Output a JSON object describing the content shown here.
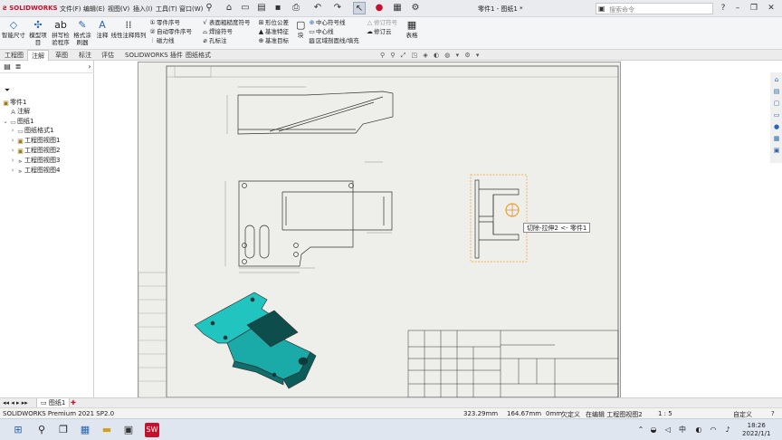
{
  "app": {
    "logo_text": "SOLIDWORKS",
    "doc_title": "零件1 - 图纸1 *"
  },
  "menu": [
    {
      "label": "文件(F)"
    },
    {
      "label": "编辑(E)"
    },
    {
      "label": "视图(V)"
    },
    {
      "label": "插入(I)"
    },
    {
      "label": "工具(T)"
    },
    {
      "label": "窗口(W)"
    }
  ],
  "search": {
    "placeholder": "搜索命令"
  },
  "ribbon": {
    "big_buttons": [
      {
        "label": "智能尺寸",
        "icon": "smart-dimension-icon"
      },
      {
        "label": "模型项目",
        "icon": "model-items-icon"
      },
      {
        "label": "拼写检验程序",
        "icon": "spell-check-icon"
      },
      {
        "label": "格式涂刷器",
        "icon": "format-painter-icon"
      },
      {
        "label": "注释",
        "icon": "note-icon"
      },
      {
        "label": "线性注释阵列",
        "icon": "linear-note-pattern-icon"
      }
    ],
    "col1": [
      "零件序号",
      "自动零件序号",
      "磁力线"
    ],
    "col2": [
      "表面粗糙度符号",
      "焊接符号",
      "孔标注"
    ],
    "col3": [
      "形位公差",
      "基准特征",
      "基准目标"
    ],
    "block_label": "块",
    "col4": [
      "中心符号线",
      "中心线",
      "区域剖面线/填充"
    ],
    "col5": [
      "修订符号",
      "修订云"
    ],
    "table_label": "表格"
  },
  "tabs": [
    {
      "label": "工程图",
      "active": false
    },
    {
      "label": "注解",
      "active": true
    },
    {
      "label": "草图",
      "active": false
    },
    {
      "label": "标注",
      "active": false
    },
    {
      "label": "评估",
      "active": false
    },
    {
      "label": "SOLIDWORKS 插件",
      "active": false
    },
    {
      "label": "图纸格式",
      "active": false
    }
  ],
  "tree": [
    {
      "label": "零件1",
      "level": 0,
      "icon": "drawing-icon"
    },
    {
      "label": "注解",
      "level": 1,
      "icon": "annotations-icon"
    },
    {
      "label": "图纸1",
      "level": 0,
      "icon": "sheet-icon"
    },
    {
      "label": "图纸格式1",
      "level": 1,
      "icon": "sheet-format-icon"
    },
    {
      "label": "工程图视图1",
      "level": 1,
      "icon": "drawing-view-icon"
    },
    {
      "label": "工程图视图2",
      "level": 1,
      "icon": "drawing-view-icon"
    },
    {
      "label": "工程图视图3",
      "level": 1,
      "icon": "drawing-view-icon"
    },
    {
      "label": "工程图视图4",
      "level": 1,
      "icon": "drawing-view-icon"
    }
  ],
  "tooltip": "切除-拉伸2 <- 零件1",
  "sheet_tab": "图纸1",
  "status": {
    "product": "SOLIDWORKS Premium 2021 SP2.0",
    "x": "323.29mm",
    "y": "164.67mm",
    "z": "0mm",
    "state": "欠定义",
    "editing": "在编辑 工程图视图2",
    "scale": "1 : 5",
    "custom": "自定义"
  },
  "clock": {
    "time": "18:26",
    "date": "2022/1/1"
  },
  "ime": "中",
  "colors": {
    "part_fill": "#22c4c0",
    "accent": "#2a66b0",
    "sheet_bg": "#eeefea",
    "selection": "#f0a030"
  }
}
